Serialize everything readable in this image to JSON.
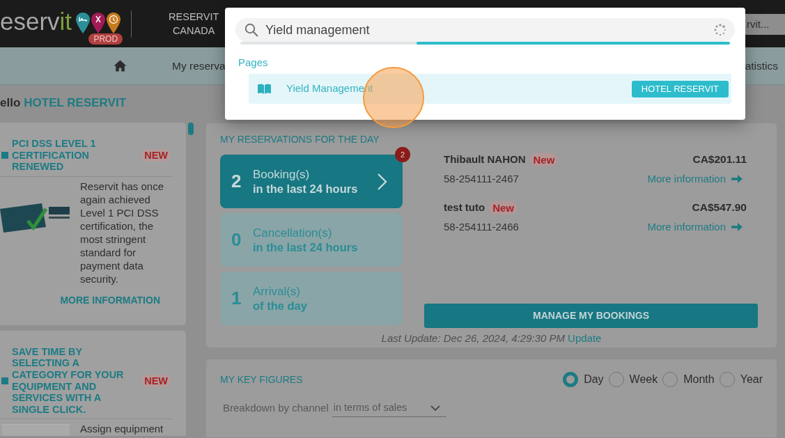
{
  "top_bar": {
    "logo": {
      "main": "eserv",
      "accent": "it",
      "environment": "PROD"
    },
    "account": "RESERVIT CANADA",
    "hotel_select": {
      "value": "rvit..."
    }
  },
  "nav": {
    "items": [
      {
        "kind": "home"
      },
      {
        "kind": "link",
        "label": "My reserva"
      },
      {
        "kind": "link",
        "label": "atistics"
      }
    ]
  },
  "search_popup": {
    "query": "Yield management",
    "loading": true,
    "loading_bar": {
      "level": 0.64
    },
    "sections": [
      {
        "title": "Pages",
        "results": [
          {
            "label": "Yield Management",
            "tag": "HOTEL RESERVIT",
            "selected": true,
            "click_marker": true
          }
        ]
      }
    ]
  },
  "greeting": {
    "prefix": "ello",
    "name": "HOTEL RESERVIT"
  },
  "news": [
    {
      "kind": "logo",
      "title": "PCI DSS LEVEL 1 CERTIFICATION RENEWED",
      "badge": "NEW",
      "text": "Reservit has once again achieved Level 1 PCI DSS certification, the most stringent standard for payment data security.",
      "link": "MORE INFORMATION"
    },
    {
      "kind": "image",
      "title": "SAVE TIME BY SELECTING A CATEGORY FOR YOUR EQUIPMENT AND SERVICES WITH A SINGLE CLICK.",
      "badge": "NEW",
      "text": "Assign equipment"
    }
  ],
  "reservations_card": {
    "title": "MY RESERVATIONS FOR THE DAY",
    "tiles": [
      {
        "count": "2",
        "label": "Booking(s)",
        "period": "in the last 24 hours",
        "selected": true,
        "badge": "2"
      },
      {
        "count": "0",
        "label": "Cancellation(s)",
        "period": "in the last 24 hours",
        "selected": false
      },
      {
        "count": "1",
        "label": "Arrival(s)",
        "period": "of the day",
        "selected": false
      }
    ],
    "bookings": [
      {
        "guest": "Thibault NAHON",
        "badge": "New",
        "number": "58-254111-2467",
        "amount": "CA$201.11",
        "link": "More information"
      },
      {
        "guest": "test tuto",
        "badge": "New",
        "number": "58-254111-2466",
        "amount": "CA$547.90",
        "link": "More information"
      }
    ],
    "button": "MANAGE MY BOOKINGS",
    "last_update": "Last Update: Dec 26, 2024, 4:29:30 PM",
    "update_link": "Update"
  },
  "key_figures_card": {
    "title": "MY KEY FIGURES",
    "periods": [
      {
        "label": "Day",
        "selected": true
      },
      {
        "label": "Week",
        "selected": false
      },
      {
        "label": "Month",
        "selected": false
      },
      {
        "label": "Year",
        "selected": false
      }
    ],
    "breakdown": {
      "label": "Breakdown by channel",
      "value": "in terms of sales"
    }
  }
}
